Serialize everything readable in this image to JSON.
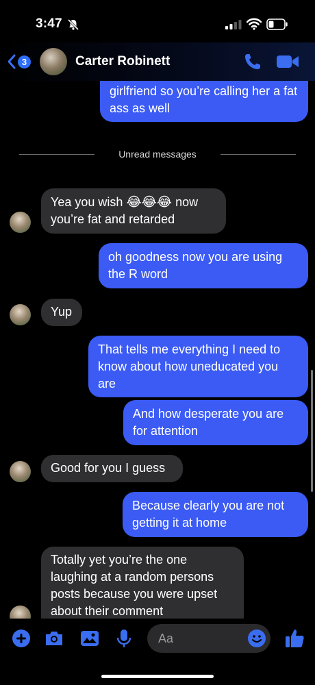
{
  "status_bar": {
    "time": "3:47"
  },
  "header": {
    "back_badge_count": "3",
    "contact_name": "Carter Robinett"
  },
  "divider_label": "Unread messages",
  "messages": [
    {
      "side": "out",
      "text": "girlfriend so you’re calling her a fat ass as well"
    },
    {
      "side": "in",
      "line1_before": "Yea you wish",
      "emojis": "😂😂😂",
      "line1_after": "now",
      "line2": "you’re fat and retarded"
    },
    {
      "side": "out",
      "text": "oh goodness now you are using the R word"
    },
    {
      "side": "in",
      "text": "Yup"
    },
    {
      "side": "out",
      "text": "That tells me everything I need to know about how uneducated you are"
    },
    {
      "side": "out",
      "text": "And how desperate you are for attention"
    },
    {
      "side": "in",
      "text": "Good for you I guess"
    },
    {
      "side": "out",
      "text": "Because clearly you are not getting it at home"
    },
    {
      "side": "in",
      "text": "Totally yet you’re the one laughing at a random persons posts because you were upset about their comment"
    }
  ],
  "composer": {
    "placeholder": "Aa"
  },
  "colors": {
    "accent": "#3b5bf4",
    "incoming_bubble": "#2f2f31",
    "icon_blue": "#3a6df0"
  },
  "icons": [
    "bell-off-icon",
    "signal-icon",
    "wifi-icon",
    "battery-icon",
    "back-chevron-icon",
    "phone-icon",
    "video-camera-icon",
    "plus-icon",
    "camera-icon",
    "image-icon",
    "microphone-icon",
    "emoji-icon",
    "thumbs-up-icon"
  ]
}
